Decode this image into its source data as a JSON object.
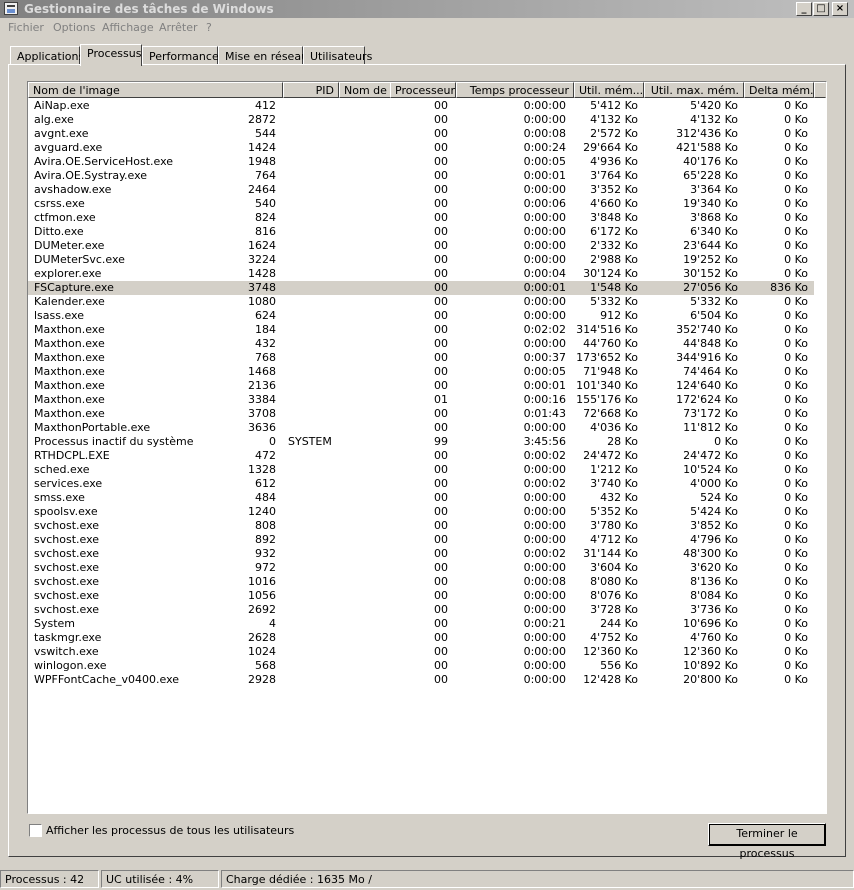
{
  "window": {
    "title": "Gestionnaire des tâches de Windows",
    "controls": {
      "minimize": "_",
      "maximize": "□",
      "close": "×"
    }
  },
  "menu": [
    "Fichier",
    "Options",
    "Affichage",
    "Arrêter",
    "?"
  ],
  "tabs": [
    "Applications",
    "Processus",
    "Performances",
    "Mise en réseau",
    "Utilisateurs"
  ],
  "active_tab": "Processus",
  "columns": [
    "Nom de l'image",
    "PID",
    "Nom de l'utilisateur",
    "Processeur",
    "Temps processeur",
    "Util. mém...",
    "Util. max. mém.",
    "Delta mém."
  ],
  "processes": [
    [
      "AiNap.exe",
      "412",
      "",
      "00",
      "0:00:00",
      "5'412 Ko",
      "5'420 Ko",
      "0 Ko"
    ],
    [
      "alg.exe",
      "2872",
      "",
      "00",
      "0:00:00",
      "4'132 Ko",
      "4'132 Ko",
      "0 Ko"
    ],
    [
      "avgnt.exe",
      "544",
      "",
      "00",
      "0:00:08",
      "2'572 Ko",
      "312'436 Ko",
      "0 Ko"
    ],
    [
      "avguard.exe",
      "1424",
      "",
      "00",
      "0:00:24",
      "29'664 Ko",
      "421'588 Ko",
      "0 Ko"
    ],
    [
      "Avira.OE.ServiceHost.exe",
      "1948",
      "",
      "00",
      "0:00:05",
      "4'936 Ko",
      "40'176 Ko",
      "0 Ko"
    ],
    [
      "Avira.OE.Systray.exe",
      "764",
      "",
      "00",
      "0:00:01",
      "3'764 Ko",
      "65'228 Ko",
      "0 Ko"
    ],
    [
      "avshadow.exe",
      "2464",
      "",
      "00",
      "0:00:00",
      "3'352 Ko",
      "3'364 Ko",
      "0 Ko"
    ],
    [
      "csrss.exe",
      "540",
      "",
      "00",
      "0:00:06",
      "4'660 Ko",
      "19'340 Ko",
      "0 Ko"
    ],
    [
      "ctfmon.exe",
      "824",
      "",
      "00",
      "0:00:00",
      "3'848 Ko",
      "3'868 Ko",
      "0 Ko"
    ],
    [
      "Ditto.exe",
      "816",
      "",
      "00",
      "0:00:00",
      "6'172 Ko",
      "6'340 Ko",
      "0 Ko"
    ],
    [
      "DUMeter.exe",
      "1624",
      "",
      "00",
      "0:00:00",
      "2'332 Ko",
      "23'644 Ko",
      "0 Ko"
    ],
    [
      "DUMeterSvc.exe",
      "3224",
      "",
      "00",
      "0:00:00",
      "2'988 Ko",
      "19'252 Ko",
      "0 Ko"
    ],
    [
      "explorer.exe",
      "1428",
      "",
      "00",
      "0:00:04",
      "30'124 Ko",
      "30'152 Ko",
      "0 Ko"
    ],
    [
      "FSCapture.exe",
      "3748",
      "",
      "00",
      "0:00:01",
      "1'548 Ko",
      "27'056 Ko",
      "836 Ko"
    ],
    [
      "Kalender.exe",
      "1080",
      "",
      "00",
      "0:00:00",
      "5'332 Ko",
      "5'332 Ko",
      "0 Ko"
    ],
    [
      "lsass.exe",
      "624",
      "",
      "00",
      "0:00:00",
      "912 Ko",
      "6'504 Ko",
      "0 Ko"
    ],
    [
      "Maxthon.exe",
      "184",
      "",
      "00",
      "0:02:02",
      "314'516 Ko",
      "352'740 Ko",
      "0 Ko"
    ],
    [
      "Maxthon.exe",
      "432",
      "",
      "00",
      "0:00:00",
      "44'760 Ko",
      "44'848 Ko",
      "0 Ko"
    ],
    [
      "Maxthon.exe",
      "768",
      "",
      "00",
      "0:00:37",
      "173'652 Ko",
      "344'916 Ko",
      "0 Ko"
    ],
    [
      "Maxthon.exe",
      "1468",
      "",
      "00",
      "0:00:05",
      "71'948 Ko",
      "74'464 Ko",
      "0 Ko"
    ],
    [
      "Maxthon.exe",
      "2136",
      "",
      "00",
      "0:00:01",
      "101'340 Ko",
      "124'640 Ko",
      "0 Ko"
    ],
    [
      "Maxthon.exe",
      "3384",
      "",
      "01",
      "0:00:16",
      "155'176 Ko",
      "172'624 Ko",
      "0 Ko"
    ],
    [
      "Maxthon.exe",
      "3708",
      "",
      "00",
      "0:01:43",
      "72'668 Ko",
      "73'172 Ko",
      "0 Ko"
    ],
    [
      "MaxthonPortable.exe",
      "3636",
      "",
      "00",
      "0:00:00",
      "4'036 Ko",
      "11'812 Ko",
      "0 Ko"
    ],
    [
      "Processus inactif du système",
      "0",
      "SYSTEM",
      "99",
      "3:45:56",
      "28 Ko",
      "0 Ko",
      "0 Ko"
    ],
    [
      "RTHDCPL.EXE",
      "472",
      "",
      "00",
      "0:00:02",
      "24'472 Ko",
      "24'472 Ko",
      "0 Ko"
    ],
    [
      "sched.exe",
      "1328",
      "",
      "00",
      "0:00:00",
      "1'212 Ko",
      "10'524 Ko",
      "0 Ko"
    ],
    [
      "services.exe",
      "612",
      "",
      "00",
      "0:00:02",
      "3'740 Ko",
      "4'000 Ko",
      "0 Ko"
    ],
    [
      "smss.exe",
      "484",
      "",
      "00",
      "0:00:00",
      "432 Ko",
      "524 Ko",
      "0 Ko"
    ],
    [
      "spoolsv.exe",
      "1240",
      "",
      "00",
      "0:00:00",
      "5'352 Ko",
      "5'424 Ko",
      "0 Ko"
    ],
    [
      "svchost.exe",
      "808",
      "",
      "00",
      "0:00:00",
      "3'780 Ko",
      "3'852 Ko",
      "0 Ko"
    ],
    [
      "svchost.exe",
      "892",
      "",
      "00",
      "0:00:00",
      "4'712 Ko",
      "4'796 Ko",
      "0 Ko"
    ],
    [
      "svchost.exe",
      "932",
      "",
      "00",
      "0:00:02",
      "31'144 Ko",
      "48'300 Ko",
      "0 Ko"
    ],
    [
      "svchost.exe",
      "972",
      "",
      "00",
      "0:00:00",
      "3'604 Ko",
      "3'620 Ko",
      "0 Ko"
    ],
    [
      "svchost.exe",
      "1016",
      "",
      "00",
      "0:00:08",
      "8'080 Ko",
      "8'136 Ko",
      "0 Ko"
    ],
    [
      "svchost.exe",
      "1056",
      "",
      "00",
      "0:00:00",
      "8'076 Ko",
      "8'084 Ko",
      "0 Ko"
    ],
    [
      "svchost.exe",
      "2692",
      "",
      "00",
      "0:00:00",
      "3'728 Ko",
      "3'736 Ko",
      "0 Ko"
    ],
    [
      "System",
      "4",
      "",
      "00",
      "0:00:21",
      "244 Ko",
      "10'696 Ko",
      "0 Ko"
    ],
    [
      "taskmgr.exe",
      "2628",
      "",
      "00",
      "0:00:00",
      "4'752 Ko",
      "4'760 Ko",
      "0 Ko"
    ],
    [
      "vswitch.exe",
      "1024",
      "",
      "00",
      "0:00:00",
      "12'360 Ko",
      "12'360 Ko",
      "0 Ko"
    ],
    [
      "winlogon.exe",
      "568",
      "",
      "00",
      "0:00:00",
      "556 Ko",
      "10'892 Ko",
      "0 Ko"
    ],
    [
      "WPFFontCache_v0400.exe",
      "2928",
      "",
      "00",
      "0:00:00",
      "12'428 Ko",
      "20'800 Ko",
      "0 Ko"
    ]
  ],
  "selected_process": "FSCapture.exe",
  "show_all_users_label": "Afficher les processus de tous les utilisateurs",
  "end_process_label": "Terminer le processus",
  "status": {
    "processes": "Processus : 42",
    "cpu": "UC utilisée : 4%",
    "commit": "Charge dédiée : 1635 Mo /"
  }
}
